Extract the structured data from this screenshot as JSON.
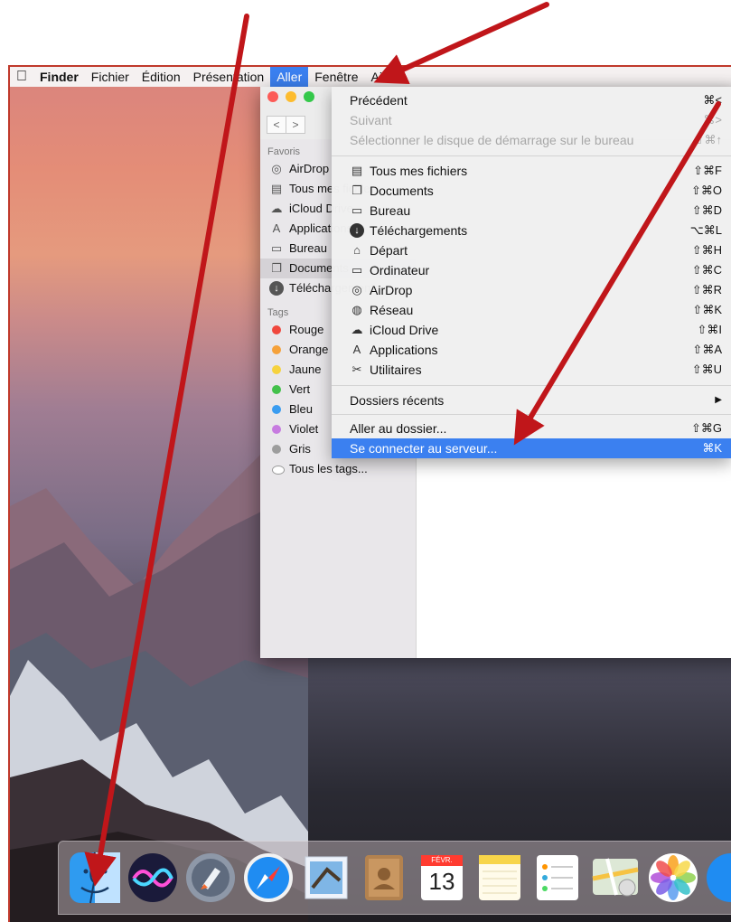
{
  "menubar": {
    "items": [
      "Finder",
      "Fichier",
      "Édition",
      "Présentation",
      "Aller",
      "Fenêtre",
      "Aide"
    ],
    "active": "Aller"
  },
  "finder_window": {
    "sidebar": {
      "favorites_header": "Favoris",
      "favorites": [
        "AirDrop",
        "Tous mes fichiers",
        "iCloud Drive",
        "Applications",
        "Bureau",
        "Documents",
        "Téléchargements"
      ],
      "selected": "Documents",
      "tags_header": "Tags",
      "tags": [
        {
          "label": "Rouge",
          "color": "#f0473d"
        },
        {
          "label": "Orange",
          "color": "#f5a13a"
        },
        {
          "label": "Jaune",
          "color": "#f6d23e"
        },
        {
          "label": "Vert",
          "color": "#43c14b"
        },
        {
          "label": "Bleu",
          "color": "#3a9cf0"
        },
        {
          "label": "Violet",
          "color": "#c77be0"
        },
        {
          "label": "Gris",
          "color": "#9d9d9d"
        }
      ],
      "all_tags": "Tous les tags..."
    }
  },
  "go_menu": {
    "back": {
      "label": "Précédent",
      "shortcut": "⌘<"
    },
    "forward": {
      "label": "Suivant",
      "shortcut": "⌘>"
    },
    "startup_disk": {
      "label": "Sélectionner le disque de démarrage sur le bureau",
      "shortcut": "⇧⌘↑"
    },
    "locations": [
      {
        "label": "Tous mes fichiers",
        "shortcut": "⇧⌘F",
        "icon": "all-files-icon"
      },
      {
        "label": "Documents",
        "shortcut": "⇧⌘O",
        "icon": "documents-icon"
      },
      {
        "label": "Bureau",
        "shortcut": "⇧⌘D",
        "icon": "desktop-icon"
      },
      {
        "label": "Téléchargements",
        "shortcut": "⌥⌘L",
        "icon": "download-icon"
      },
      {
        "label": "Départ",
        "shortcut": "⇧⌘H",
        "icon": "home-icon"
      },
      {
        "label": "Ordinateur",
        "shortcut": "⇧⌘C",
        "icon": "computer-icon"
      },
      {
        "label": "AirDrop",
        "shortcut": "⇧⌘R",
        "icon": "airdrop-icon"
      },
      {
        "label": "Réseau",
        "shortcut": "⇧⌘K",
        "icon": "network-icon"
      },
      {
        "label": "iCloud Drive",
        "shortcut": "⇧⌘I",
        "icon": "cloud-icon"
      },
      {
        "label": "Applications",
        "shortcut": "⇧⌘A",
        "icon": "applications-icon"
      },
      {
        "label": "Utilitaires",
        "shortcut": "⇧⌘U",
        "icon": "utilities-icon"
      }
    ],
    "recent": {
      "label": "Dossiers récents",
      "shortcut": "▶"
    },
    "goto_folder": {
      "label": "Aller au dossier...",
      "shortcut": "⇧⌘G"
    },
    "connect": {
      "label": "Se connecter au serveur...",
      "shortcut": "⌘K"
    }
  },
  "dock": {
    "calendar_month": "FÉVR.",
    "calendar_day": "13",
    "apps": [
      "Finder",
      "Siri",
      "Launchpad",
      "Safari",
      "Mail",
      "Contacts",
      "Calendrier",
      "Notes",
      "Rappels",
      "Plans",
      "Photos"
    ]
  },
  "colors": {
    "accent": "#3b80f0",
    "annotation_arrow": "#c0161a"
  }
}
